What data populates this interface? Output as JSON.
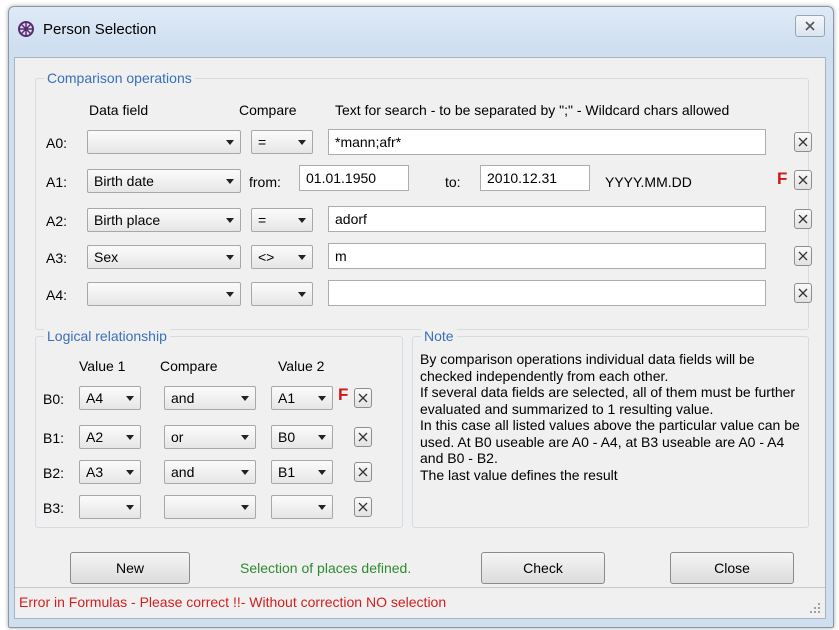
{
  "window": {
    "title": "Person Selection"
  },
  "comparison": {
    "label": "Comparison operations",
    "headers": {
      "data_field": "Data field",
      "compare": "Compare",
      "text": "Text for search - to be separated by \";\" - Wildcard chars allowed"
    },
    "rows": [
      {
        "label": "A0:",
        "field": "",
        "compare": "=",
        "value": "*mann;afr*"
      },
      {
        "label": "A1:",
        "field": "Birth date",
        "from_label": "from:",
        "from": "01.01.1950",
        "to_label": "to:",
        "to": "2010.12.31",
        "format": "YYYY.MM.DD",
        "flag": "F"
      },
      {
        "label": "A2:",
        "field": "Birth place",
        "compare": "=",
        "value": "adorf"
      },
      {
        "label": "A3:",
        "field": "Sex",
        "compare": "<>",
        "value": "m"
      },
      {
        "label": "A4:",
        "field": "",
        "compare": "",
        "value": ""
      }
    ]
  },
  "logical": {
    "label": "Logical relationship",
    "headers": {
      "v1": "Value 1",
      "compare": "Compare",
      "v2": "Value 2"
    },
    "rows": [
      {
        "label": "B0:",
        "v1": "A4",
        "op": "and",
        "v2": "A1",
        "flag": "F"
      },
      {
        "label": "B1:",
        "v1": "A2",
        "op": "or",
        "v2": "B0"
      },
      {
        "label": "B2:",
        "v1": "A3",
        "op": "and",
        "v2": "B1"
      },
      {
        "label": "B3:",
        "v1": "",
        "op": "",
        "v2": ""
      }
    ]
  },
  "note": {
    "label": "Note",
    "text": "By comparison operations individual data fields will be checked independently from each other.\nIf several data fields are selected, all of them must be further evaluated and summarized to 1 resulting value.\nIn this case all listed values above the particular value can be used. At B0 useable are A0 - A4, at B3 useable are A0 - A4 and B0 - B2.\nThe last value defines the result"
  },
  "buttons": {
    "new": "New",
    "check": "Check",
    "close": "Close"
  },
  "info": "Selection of places defined.",
  "status": "Error in Formulas - Please correct !!- Without correction NO selection",
  "colors": {
    "error": "#d21e1e",
    "info": "#2f8a2f",
    "group_label": "#3a6fb8"
  }
}
